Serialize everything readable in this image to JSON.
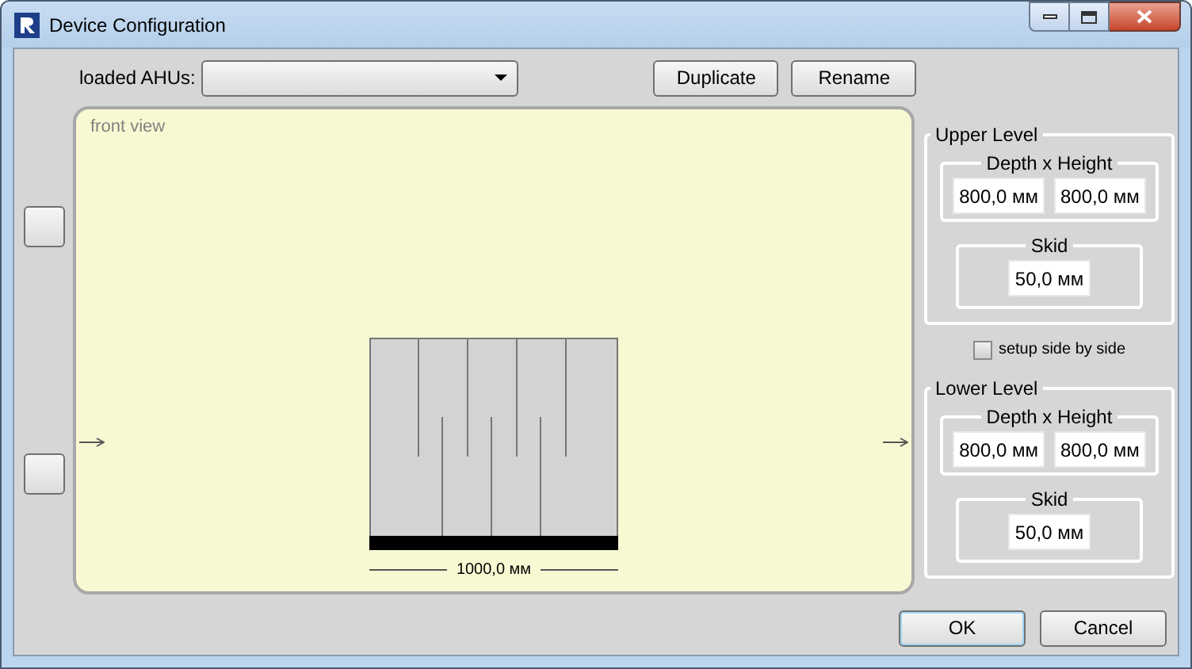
{
  "window": {
    "title": "Device Configuration"
  },
  "toolbar": {
    "label": "loaded AHUs:",
    "buttons": [
      "Duplicate",
      "Rename"
    ]
  },
  "canvas": {
    "title": "front view",
    "dimension": "1000,0 мм"
  },
  "upper_level": {
    "title": "Upper Level",
    "size_group": "Depth x Height",
    "depth": "800,0 мм",
    "height": "800,0 мм",
    "skid_group": "Skid",
    "skid": "50,0 мм"
  },
  "side_by_side": {
    "label": "setup side by side",
    "checked": false
  },
  "lower_level": {
    "title": "Lower Level",
    "size_group": "Depth x Height",
    "depth": "800,0 мм",
    "height": "800,0 мм",
    "skid_group": "Skid",
    "skid": "50,0 мм"
  },
  "buttons": [
    "OK",
    "Cancel"
  ]
}
